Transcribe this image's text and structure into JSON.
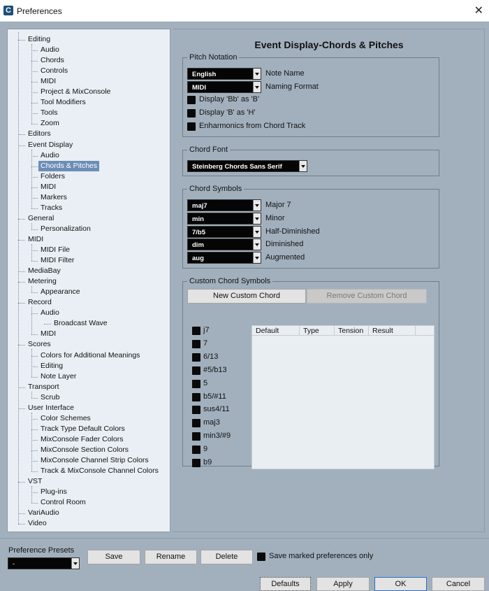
{
  "window": {
    "title": "Preferences",
    "app_icon_glyph": "C"
  },
  "tree": {
    "items": [
      {
        "label": "Editing",
        "level": 0
      },
      {
        "label": "Audio",
        "level": 1
      },
      {
        "label": "Chords",
        "level": 1
      },
      {
        "label": "Controls",
        "level": 1
      },
      {
        "label": "MIDI",
        "level": 1
      },
      {
        "label": "Project & MixConsole",
        "level": 1
      },
      {
        "label": "Tool Modifiers",
        "level": 1
      },
      {
        "label": "Tools",
        "level": 1
      },
      {
        "label": "Zoom",
        "level": 1
      },
      {
        "label": "Editors",
        "level": 0
      },
      {
        "label": "Event Display",
        "level": 0
      },
      {
        "label": "Audio",
        "level": 1
      },
      {
        "label": "Chords & Pitches",
        "level": 1,
        "selected": true
      },
      {
        "label": "Folders",
        "level": 1
      },
      {
        "label": "MIDI",
        "level": 1
      },
      {
        "label": "Markers",
        "level": 1
      },
      {
        "label": "Tracks",
        "level": 1
      },
      {
        "label": "General",
        "level": 0
      },
      {
        "label": "Personalization",
        "level": 1
      },
      {
        "label": "MIDI",
        "level": 0
      },
      {
        "label": "MIDI File",
        "level": 1
      },
      {
        "label": "MIDI Filter",
        "level": 1
      },
      {
        "label": "MediaBay",
        "level": 0
      },
      {
        "label": "Metering",
        "level": 0
      },
      {
        "label": "Appearance",
        "level": 1
      },
      {
        "label": "Record",
        "level": 0
      },
      {
        "label": "Audio",
        "level": 1
      },
      {
        "label": "Broadcast Wave",
        "level": 2
      },
      {
        "label": "MIDI",
        "level": 1
      },
      {
        "label": "Scores",
        "level": 0
      },
      {
        "label": "Colors for Additional Meanings",
        "level": 1
      },
      {
        "label": "Editing",
        "level": 1
      },
      {
        "label": "Note Layer",
        "level": 1
      },
      {
        "label": "Transport",
        "level": 0
      },
      {
        "label": "Scrub",
        "level": 1
      },
      {
        "label": "User Interface",
        "level": 0
      },
      {
        "label": "Color Schemes",
        "level": 1
      },
      {
        "label": "Track Type Default Colors",
        "level": 1
      },
      {
        "label": "MixConsole Fader Colors",
        "level": 1
      },
      {
        "label": "MixConsole Section Colors",
        "level": 1
      },
      {
        "label": "MixConsole Channel Strip Colors",
        "level": 1
      },
      {
        "label": "Track & MixConsole Channel Colors",
        "level": 1
      },
      {
        "label": "VST",
        "level": 0
      },
      {
        "label": "Plug-ins",
        "level": 1
      },
      {
        "label": "Control Room",
        "level": 1
      },
      {
        "label": "VariAudio",
        "level": 0
      },
      {
        "label": "Video",
        "level": 0
      }
    ]
  },
  "page": {
    "title": "Event Display-Chords & Pitches",
    "pitch_notation": {
      "legend": "Pitch Notation",
      "note_name": {
        "value": "English",
        "label": "Note Name"
      },
      "naming_format": {
        "value": "MIDI",
        "label": "Naming Format"
      },
      "checkboxes": [
        "Display 'Bb' as 'B'",
        "Display 'B' as 'H'",
        "Enharmonics from Chord Track"
      ]
    },
    "chord_font": {
      "legend": "Chord Font",
      "value": "Steinberg Chords Sans Serif"
    },
    "chord_symbols": {
      "legend": "Chord Symbols",
      "rows": [
        {
          "value": "maj7",
          "label": "Major 7"
        },
        {
          "value": "min",
          "label": "Minor"
        },
        {
          "value": "7/b5",
          "label": "Half-Diminished"
        },
        {
          "value": "dim",
          "label": "Diminished"
        },
        {
          "value": "aug",
          "label": "Augmented"
        }
      ]
    },
    "custom_chord_symbols": {
      "legend": "Custom Chord Symbols",
      "new_button": "New Custom Chord",
      "remove_button": "Remove Custom Chord",
      "checkboxes": [
        "j7",
        "7",
        "6/13",
        "#5/b13",
        "5",
        "b5/#11",
        "sus4/11",
        "maj3",
        "min3/#9",
        "9",
        "b9"
      ],
      "columns": [
        "Default",
        "Type",
        "Tension",
        "Result"
      ]
    }
  },
  "bottom": {
    "presets_label": "Preference Presets",
    "presets_value": "-",
    "save": "Save",
    "rename": "Rename",
    "delete": "Delete",
    "save_marked": "Save marked preferences only",
    "defaults": "Defaults",
    "apply": "Apply",
    "ok": "OK",
    "cancel": "Cancel"
  },
  "colors": {
    "panel_bg": "#a2b0bd",
    "tree_bg": "#e9eff4",
    "selected_bg": "#6c8db5",
    "dropdown_bg": "#050505"
  }
}
